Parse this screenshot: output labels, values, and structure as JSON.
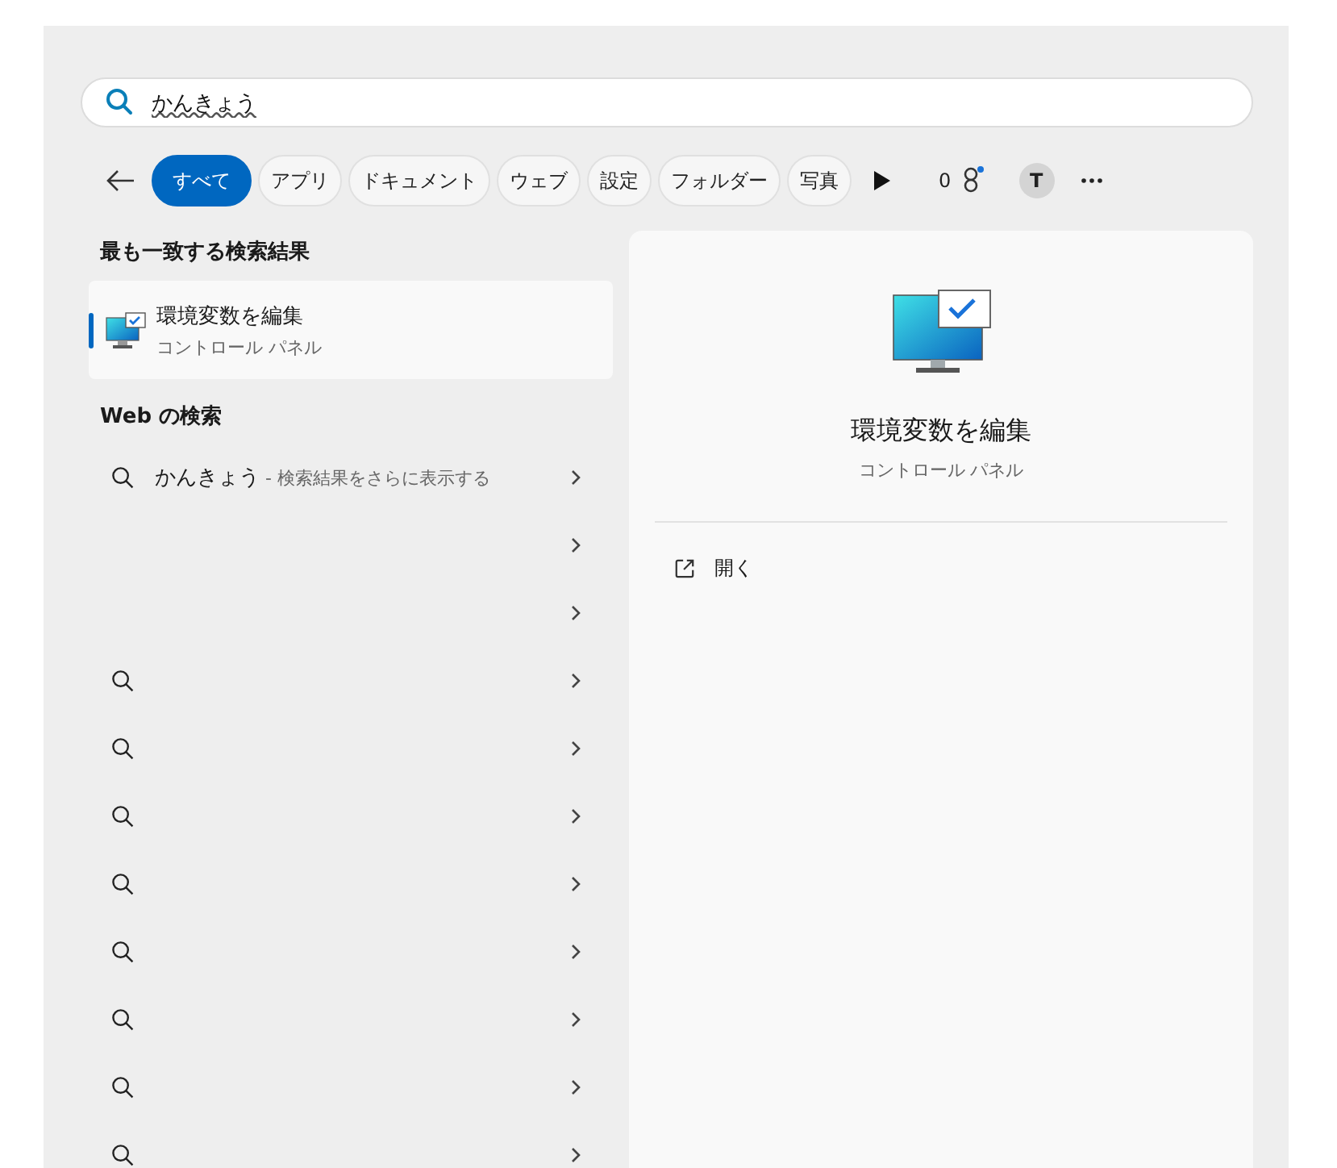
{
  "search": {
    "value": "かんきょう"
  },
  "filters": [
    {
      "label": "すべて",
      "selected": true
    },
    {
      "label": "アプリ",
      "selected": false
    },
    {
      "label": "ドキュメント",
      "selected": false
    },
    {
      "label": "ウェブ",
      "selected": false
    },
    {
      "label": "設定",
      "selected": false
    },
    {
      "label": "フォルダー",
      "selected": false
    },
    {
      "label": "写真",
      "selected": false
    }
  ],
  "rewards": {
    "count": "0"
  },
  "avatar": {
    "initial": "T"
  },
  "best_match": {
    "heading": "最も一致する検索結果",
    "result": {
      "title": "環境変数を編集",
      "subtitle": "コントロール パネル",
      "selected": true
    }
  },
  "web": {
    "heading": "Web の検索",
    "results": [
      {
        "kind": "query",
        "query": "かんきょう",
        "hint": " - 検索結果をさらに表示する"
      },
      {
        "kind": "blank"
      },
      {
        "kind": "blank"
      },
      {
        "kind": "search"
      },
      {
        "kind": "search"
      },
      {
        "kind": "search"
      },
      {
        "kind": "search"
      },
      {
        "kind": "search"
      },
      {
        "kind": "search"
      },
      {
        "kind": "search"
      },
      {
        "kind": "search"
      }
    ]
  },
  "detail": {
    "title": "環境変数を編集",
    "subtitle": "コントロール パネル",
    "actions": [
      {
        "label": "開く"
      }
    ]
  }
}
